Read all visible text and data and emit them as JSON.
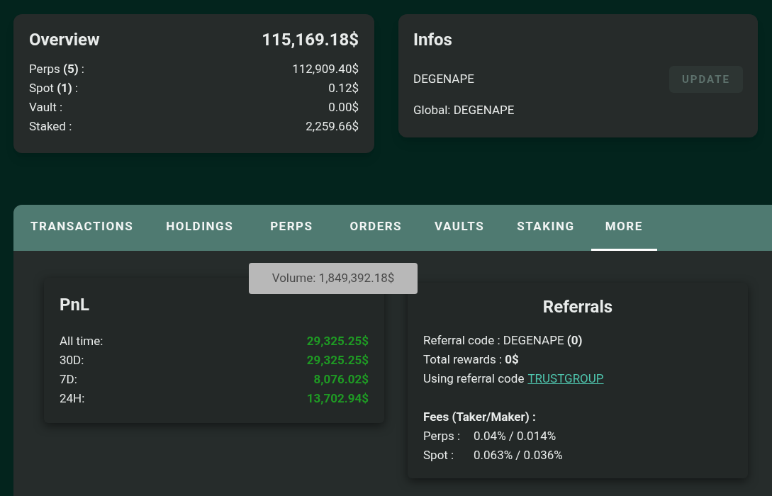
{
  "overview": {
    "title": "Overview",
    "total": "115,169.18$",
    "rows": [
      {
        "label": "Perps **(5)** :",
        "value": "112,909.40$"
      },
      {
        "label": "Spot **(1)** :",
        "value": "0.12$"
      },
      {
        "label": "Vault :",
        "value": "0.00$"
      },
      {
        "label": "Staked :",
        "value": "2,259.66$"
      }
    ]
  },
  "infos": {
    "title": "Infos",
    "name": "DEGENAPE",
    "global": "Global: DEGENAPE",
    "update_button": {
      "label": "UPDATE",
      "disabled": true
    }
  },
  "tabs": [
    {
      "label": "TRANSACTIONS",
      "selected": false
    },
    {
      "label": "HOLDINGS",
      "selected": false
    },
    {
      "label": "PERPS",
      "selected": false
    },
    {
      "label": "ORDERS",
      "selected": false
    },
    {
      "label": "VAULTS",
      "selected": false
    },
    {
      "label": "STAKING",
      "selected": false
    },
    {
      "label": "MORE",
      "selected": true
    }
  ],
  "pnl": {
    "title": "PnL",
    "tooltip": "Volume: 1,849,392.18$",
    "rows": [
      {
        "label": "All time:",
        "value": "29,325.25$"
      },
      {
        "label": "30D:",
        "value": "29,325.25$"
      },
      {
        "label": "7D:",
        "value": "8,076.02$"
      },
      {
        "label": "24H:",
        "value": "13,702.94$"
      }
    ]
  },
  "referrals": {
    "title": "Referrals",
    "lines": [
      "Referral code : DEGENAPE **(0)**",
      "Total rewards : **0$**"
    ],
    "using_text": "Using referral code",
    "using_link": "TRUSTGROUP",
    "fees_title": "Fees (Taker/Maker) :",
    "fees": [
      {
        "label": "Perps :",
        "value": "0.04% / 0.014%"
      },
      {
        "label": "Spot :",
        "value": "0.063% / 0.036%"
      }
    ]
  }
}
